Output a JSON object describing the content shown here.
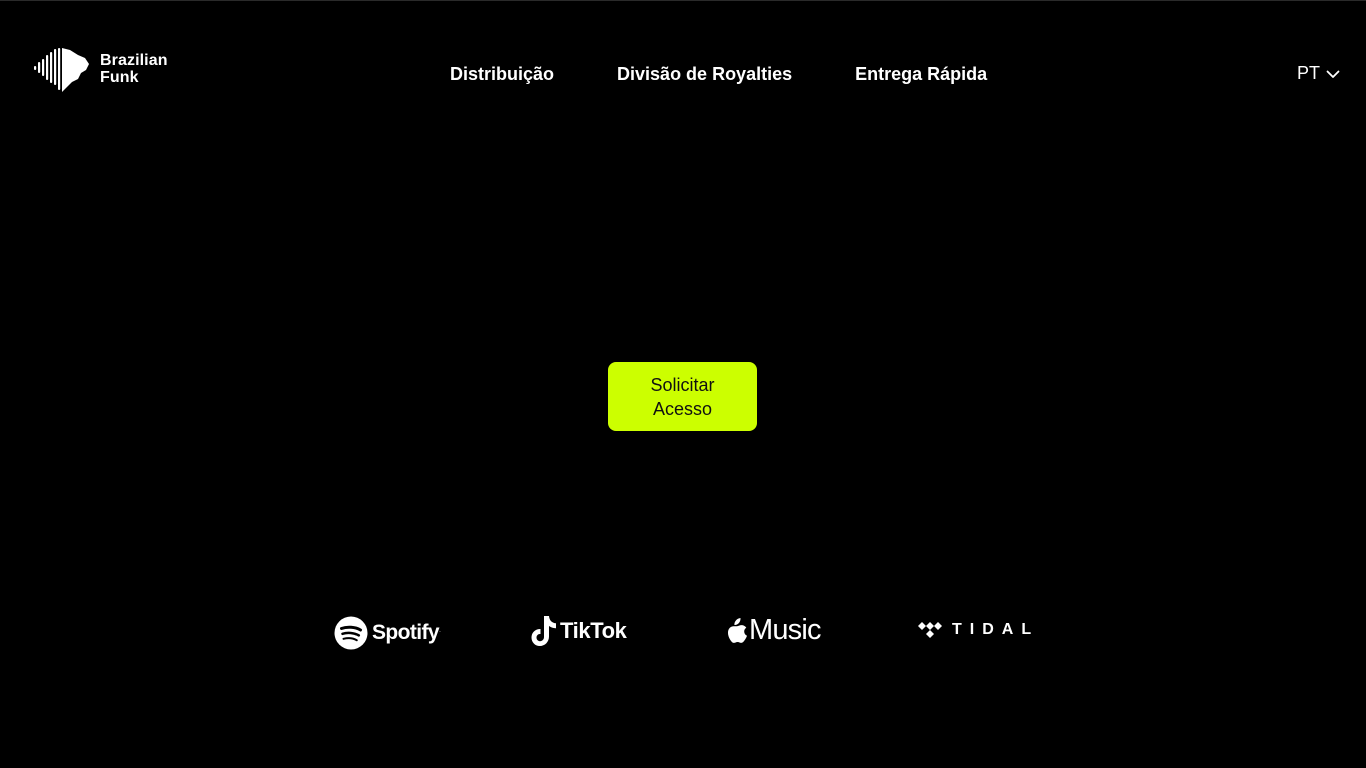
{
  "brand": {
    "line1": "Brazilian",
    "line2": "Funk"
  },
  "nav": {
    "items": [
      {
        "label": "Distribuição"
      },
      {
        "label": "Divisão de Royalties"
      },
      {
        "label": "Entrega Rápida"
      }
    ]
  },
  "language": {
    "selected": "PT",
    "icon": "chevron-down-icon"
  },
  "cta": {
    "line1": "Solicitar",
    "line2": "Acesso",
    "color": "#ccff00"
  },
  "partners": {
    "spotify": {
      "name": "Spotify",
      "mark": "·",
      "icon": "spotify-icon"
    },
    "tiktok": {
      "name": "TikTok",
      "icon": "tiktok-icon"
    },
    "apple_music": {
      "name": "Music",
      "icon": "apple-icon"
    },
    "tidal": {
      "name": "TIDAL",
      "icon": "tidal-icon"
    }
  },
  "colors": {
    "background": "#000000",
    "text": "#ffffff",
    "accent": "#ccff00"
  }
}
